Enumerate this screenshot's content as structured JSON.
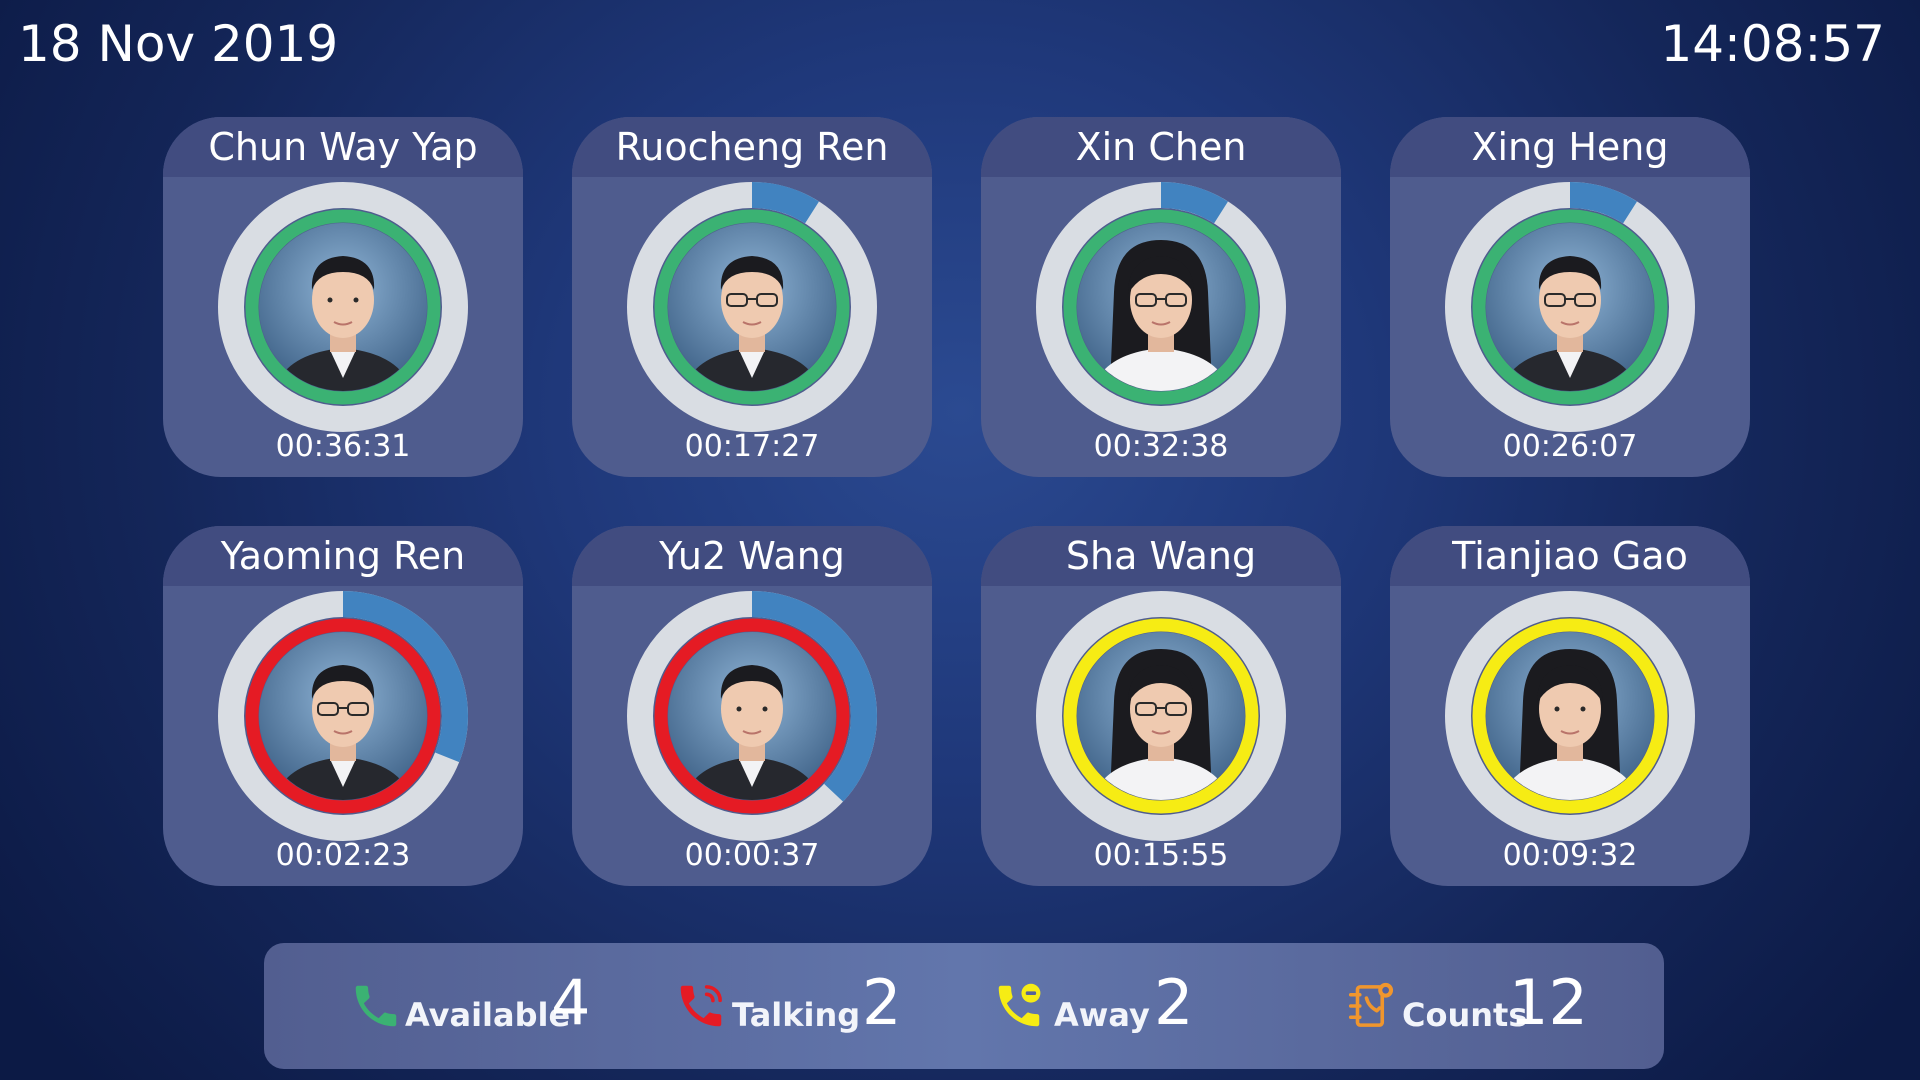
{
  "header": {
    "date": "18 Nov 2019",
    "time": "14:08:57"
  },
  "colors": {
    "available": "#3bb273",
    "talking": "#e51b24",
    "away": "#f6ec14",
    "progress": "#4183c0",
    "track": "#d9dde3",
    "card": "#4f5c8e",
    "card_header": "#414c80"
  },
  "agents": [
    {
      "name": "Chun Way Yap",
      "timer": "00:36:31",
      "status": "available",
      "progress": 0.0,
      "icon": "avatar-man-short-hair"
    },
    {
      "name": "Ruocheng Ren",
      "timer": "00:17:27",
      "status": "available",
      "progress": 0.09,
      "icon": "avatar-man-glasses"
    },
    {
      "name": "Xin Chen",
      "timer": "00:32:38",
      "status": "available",
      "progress": 0.09,
      "icon": "avatar-woman-glasses"
    },
    {
      "name": "Xing Heng",
      "timer": "00:26:07",
      "status": "available",
      "progress": 0.09,
      "icon": "avatar-man-glasses"
    },
    {
      "name": "Yaoming Ren",
      "timer": "00:02:23",
      "status": "talking",
      "progress": 0.31,
      "icon": "avatar-man-glasses"
    },
    {
      "name": "Yu2 Wang",
      "timer": "00:00:37",
      "status": "talking",
      "progress": 0.37,
      "icon": "avatar-man-short-hair"
    },
    {
      "name": "Sha Wang",
      "timer": "00:15:55",
      "status": "away",
      "progress": 0.0,
      "icon": "avatar-woman-glasses"
    },
    {
      "name": "Tianjiao Gao",
      "timer": "00:09:32",
      "status": "away",
      "progress": 0.0,
      "icon": "avatar-woman-long-hair"
    }
  ],
  "summary": {
    "available": {
      "label": "Available",
      "count": "4",
      "icon": "phone-icon"
    },
    "talking": {
      "label": "Talking",
      "count": "2",
      "icon": "phone-ringing-icon"
    },
    "away": {
      "label": "Away",
      "count": "2",
      "icon": "phone-away-icon"
    },
    "counts": {
      "label": "Counts",
      "count": "12",
      "icon": "phone-book-icon"
    }
  }
}
